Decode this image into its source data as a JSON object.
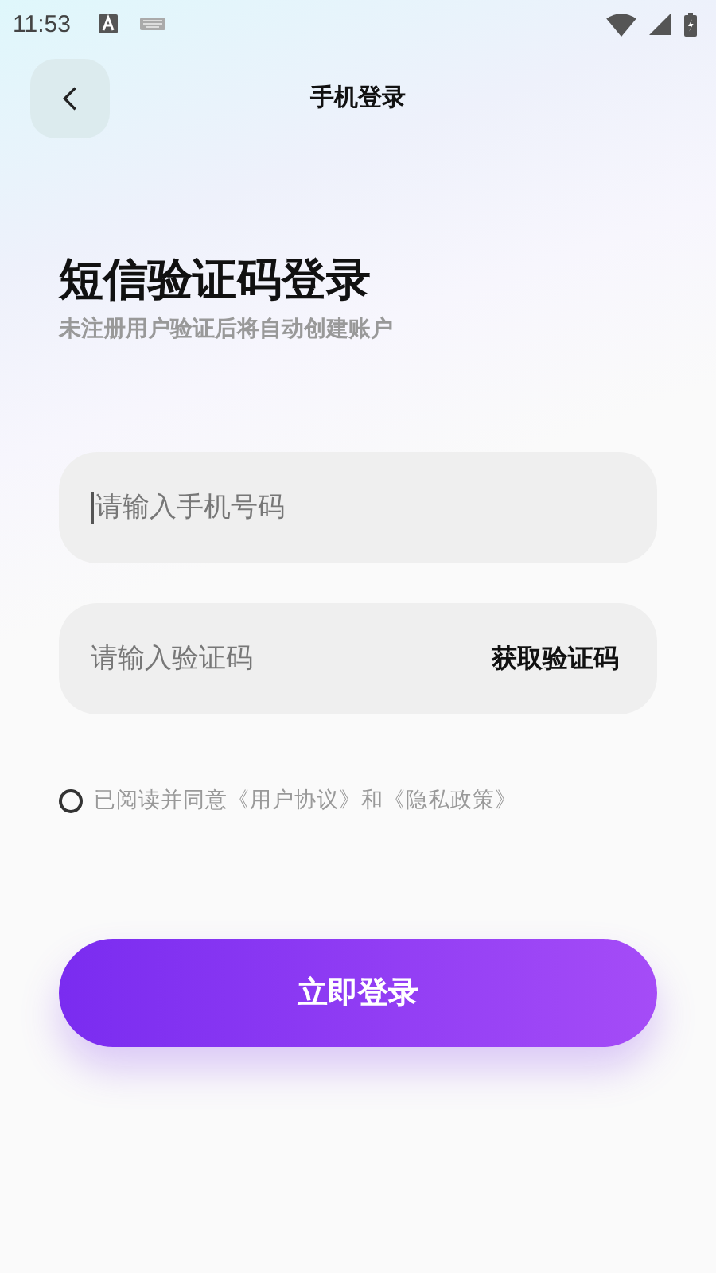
{
  "status_bar": {
    "time": "11:53"
  },
  "header": {
    "title": "手机登录"
  },
  "heading": {
    "title": "短信验证码登录",
    "subtitle": "未注册用户验证后将自动创建账户"
  },
  "fields": [
    {
      "kind": "phone",
      "placeholder": "请输入手机号码",
      "focused": true
    },
    {
      "kind": "code",
      "placeholder": "请输入验证码",
      "action": "获取验证码"
    }
  ],
  "agreement": {
    "checked": false,
    "text": "已阅读并同意《用户协议》和《隐私政策》"
  },
  "login_button": {
    "label": "立即登录"
  }
}
